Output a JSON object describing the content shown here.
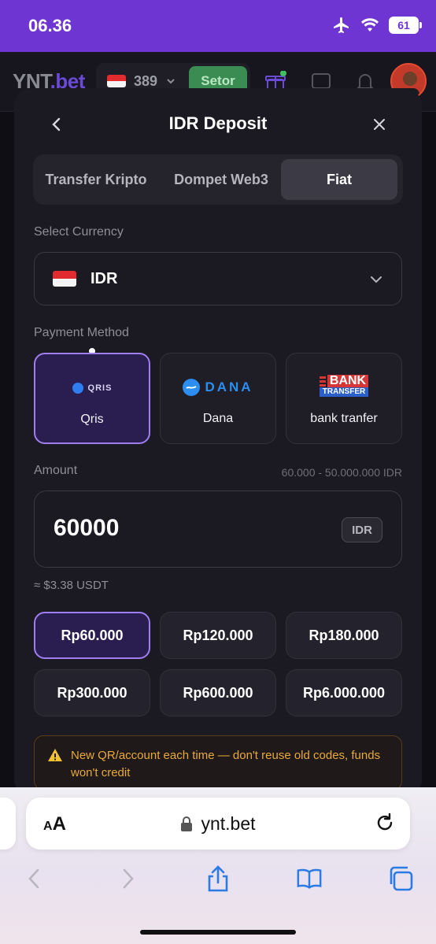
{
  "status_bar": {
    "time": "06.36",
    "battery": "61"
  },
  "app_header": {
    "logo_main": "YNT",
    "logo_suffix": ".bet",
    "balance": "389",
    "setor_label": "Setor"
  },
  "modal": {
    "title": "IDR Deposit",
    "tabs": [
      {
        "label": "Transfer Kripto",
        "active": false
      },
      {
        "label": "Dompet Web3",
        "active": false
      },
      {
        "label": "Fiat",
        "active": true
      }
    ],
    "select_currency_label": "Select Currency",
    "currency": "IDR",
    "payment_method_label": "Payment Method",
    "payment_methods": [
      {
        "label": "Qris",
        "logo_text": "QRIS",
        "active": true
      },
      {
        "label": "Dana",
        "logo_text": "DANA",
        "active": false
      },
      {
        "label": "bank tranfer",
        "logo_text_top": "BANK",
        "logo_text_bottom": "TRANSFER",
        "active": false
      }
    ],
    "amount_label": "Amount",
    "amount_range": "60.000 - 50.000.000 IDR",
    "amount_value": "60000",
    "amount_unit": "IDR",
    "approx_value": "≈ $3.38 USDT",
    "presets": [
      {
        "label": "Rp60.000",
        "active": true
      },
      {
        "label": "Rp120.000",
        "active": false
      },
      {
        "label": "Rp180.000",
        "active": false
      },
      {
        "label": "Rp300.000",
        "active": false
      },
      {
        "label": "Rp600.000",
        "active": false
      },
      {
        "label": "Rp6.000.000",
        "active": false
      }
    ],
    "warning_text": "New QR/account each time — don't reuse old codes, funds won't credit"
  },
  "browser": {
    "aa_small": "A",
    "aa_big": "A",
    "url": "ynt.bet"
  },
  "colors": {
    "status_bar": "#6f35d3",
    "accent_border": "#9f7ef0",
    "warning": "#e9a93b"
  }
}
